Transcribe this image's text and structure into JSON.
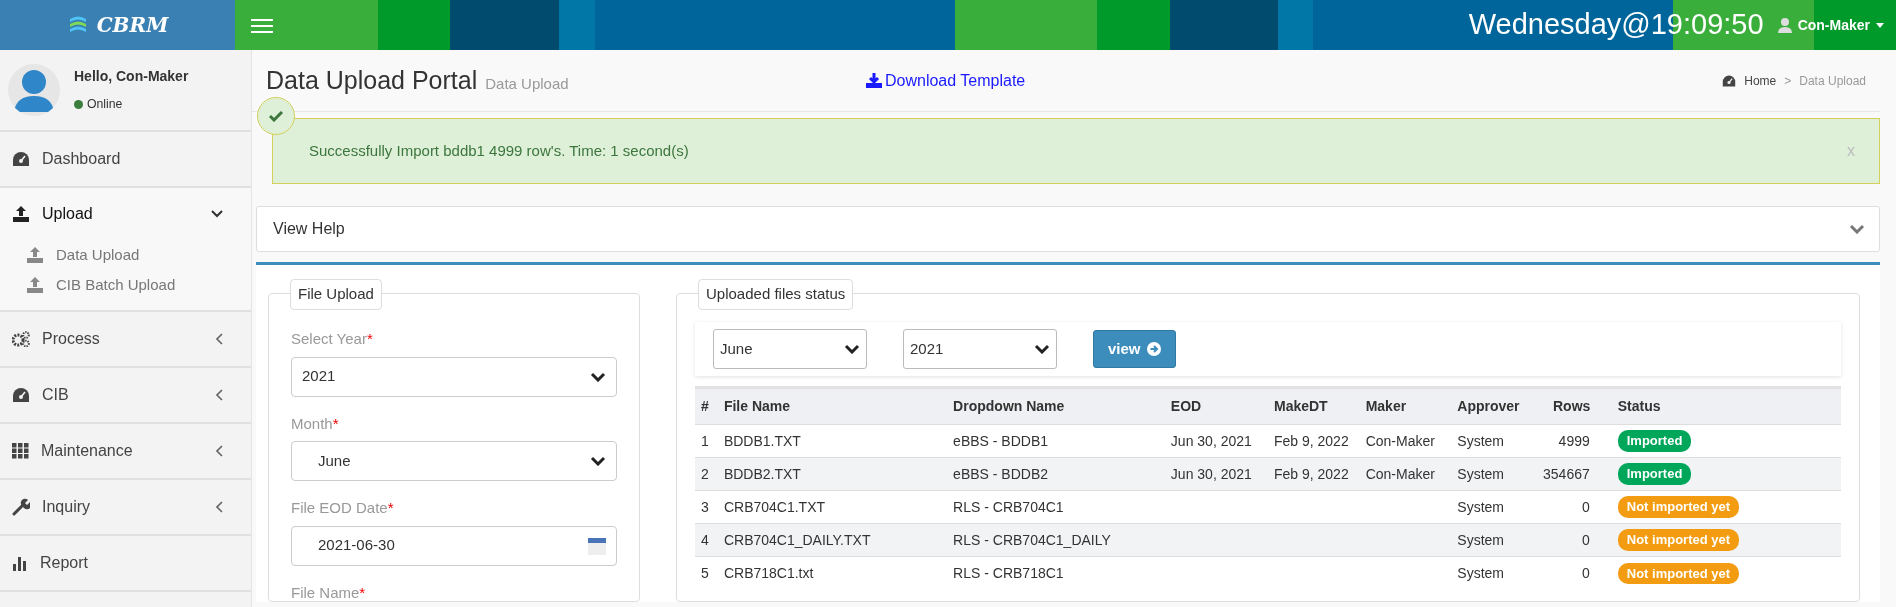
{
  "topbar": {
    "logo": "CBRM",
    "clock": "Wednesday@19:09:50",
    "user": "Con-Maker"
  },
  "user_panel": {
    "greeting": "Hello, Con-Maker",
    "status": "Online"
  },
  "sidebar": {
    "items": [
      {
        "label": "Dashboard"
      },
      {
        "label": "Upload",
        "expanded": true,
        "children": [
          {
            "label": "Data Upload"
          },
          {
            "label": "CIB Batch Upload"
          }
        ]
      },
      {
        "label": "Process",
        "expanded": false
      },
      {
        "label": "CIB",
        "expanded": false
      },
      {
        "label": "Maintenance",
        "expanded": false
      },
      {
        "label": "Inquiry",
        "expanded": false
      },
      {
        "label": "Report"
      }
    ]
  },
  "page_header": {
    "title": "Data Upload Portal",
    "subtitle": "Data Upload",
    "download_link": "Download Template",
    "breadcrumb": [
      {
        "label": "Home"
      },
      {
        "label": "Data Upload"
      }
    ],
    "breadcrumb_separator": ">"
  },
  "alert": {
    "message": "Successfully Import bddb1 4999 row's. Time: 1 second(s)",
    "close": "x"
  },
  "help_panel": {
    "title": "View Help",
    "expanded": false
  },
  "file_upload": {
    "legend": "File Upload",
    "required_marker": "*",
    "fields": [
      {
        "label": "Select Year",
        "required": true,
        "kind": "select",
        "value": "2021"
      },
      {
        "label": "Month",
        "required": true,
        "kind": "select",
        "value": "June"
      },
      {
        "label": "File EOD Date",
        "required": true,
        "kind": "date",
        "value": "2021-06-30"
      },
      {
        "label": "File Name",
        "required": true,
        "kind": "label"
      }
    ]
  },
  "files_status": {
    "legend": "Uploaded files status",
    "month": "June",
    "year": "2021",
    "view_button": "view",
    "table": {
      "columns": [
        "#",
        "File Name",
        "Dropdown Name",
        "EOD",
        "MakeDT",
        "Maker",
        "Approver",
        "Rows",
        "Status"
      ],
      "rows": [
        {
          "cells": [
            "1",
            "BDDB1.TXT",
            "eBBS - BDDB1",
            "Jun 30, 2021",
            "Feb 9, 2022",
            "Con-Maker",
            "System",
            "4999"
          ],
          "status": {
            "label": "Imported",
            "kind": "imported"
          }
        },
        {
          "cells": [
            "2",
            "BDDB2.TXT",
            "eBBS - BDDB2",
            "Jun 30, 2021",
            "Feb 9, 2022",
            "Con-Maker",
            "System",
            "354667"
          ],
          "status": {
            "label": "Imported",
            "kind": "imported"
          }
        },
        {
          "cells": [
            "3",
            "CRB704C1.TXT",
            "RLS - CRB704C1",
            "",
            "",
            "",
            "System",
            "0"
          ],
          "status": {
            "label": "Not imported yet",
            "kind": "pending"
          }
        },
        {
          "cells": [
            "4",
            "CRB704C1_DAILY.TXT",
            "RLS - CRB704C1_DAILY",
            "",
            "",
            "",
            "System",
            "0"
          ],
          "status": {
            "label": "Not imported yet",
            "kind": "pending"
          }
        },
        {
          "cells": [
            "5",
            "CRB718C1.txt",
            "RLS - CRB718C1",
            "",
            "",
            "",
            "System",
            "0"
          ],
          "status": {
            "label": "Not imported yet",
            "kind": "pending"
          }
        }
      ]
    }
  }
}
